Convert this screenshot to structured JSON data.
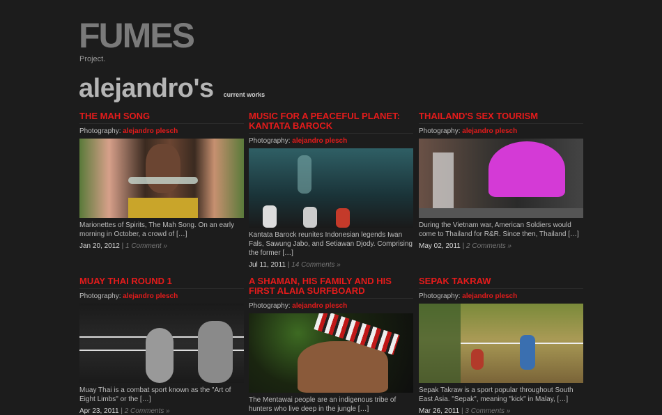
{
  "site": {
    "logo": "FUMES",
    "tagline": "Project."
  },
  "heading": {
    "name": "alejandro's",
    "sub": "current works"
  },
  "credit_prefix": "Photography:",
  "posts": [
    {
      "title": "THE MAH SONG",
      "author": "alejandro plesch",
      "excerpt": "Marionettes of Spirits, The Mah Song. On an early morning in October, a crowd of […]",
      "date": "Jan 20, 2012",
      "comments": "1 Comment »"
    },
    {
      "title": "MUSIC FOR A PEACEFUL PLANET: KANTATA BAROCK",
      "author": "alejandro plesch",
      "excerpt": "Kantata Barock reunites Indonesian legends Iwan Fals, Sawung Jabo, and Setiawan Djody. Comprising the former […]",
      "date": "Jul 11, 2011",
      "comments": "14 Comments »"
    },
    {
      "title": "THAILAND'S SEX TOURISM",
      "author": "alejandro plesch",
      "excerpt": "During the Vietnam war, American Soldiers would come to Thailand for R&R. Since then, Thailand […]",
      "date": "May 02, 2011",
      "comments": "2 Comments »"
    },
    {
      "title": "MUAY THAI ROUND 1",
      "author": "alejandro plesch",
      "excerpt": "Muay Thai is a combat sport known as the \"Art of Eight Limbs\" or the […]",
      "date": "Apr 23, 2011",
      "comments": "2 Comments »"
    },
    {
      "title": "A SHAMAN, HIS FAMILY AND HIS FIRST ALAIA SURFBOARD",
      "author": "alejandro plesch",
      "excerpt": "The Mentawai people are an indigenous tribe of hunters who live deep in the jungle […]",
      "date": "",
      "comments": ""
    },
    {
      "title": "SEPAK TAKRAW",
      "author": "alejandro plesch",
      "excerpt": "Sepak Takraw is a sport popular throughout South East Asia. \"Sepak\", meaning \"kick\" in Malay, […]",
      "date": "Mar 26, 2011",
      "comments": "3 Comments »"
    }
  ]
}
